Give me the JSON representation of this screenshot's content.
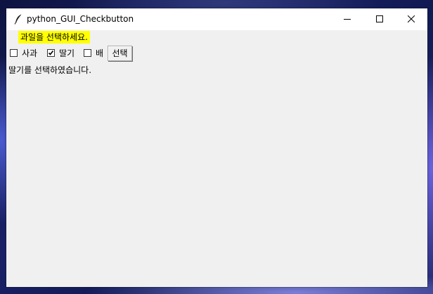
{
  "window": {
    "title": "python_GUI_Checkbutton",
    "icon": "feather-icon",
    "controls": {
      "minimize": "minimize-icon",
      "maximize": "maximize-icon",
      "close": "close-icon"
    }
  },
  "prompt": {
    "text": "과일을 선택하세요.",
    "background": "#ffff00"
  },
  "checkboxes": [
    {
      "label": "사과",
      "checked": false
    },
    {
      "label": "딸기",
      "checked": true
    },
    {
      "label": "배",
      "checked": false
    }
  ],
  "select_button": {
    "label": "선택"
  },
  "result": {
    "text": "딸기를 선택하였습니다."
  }
}
